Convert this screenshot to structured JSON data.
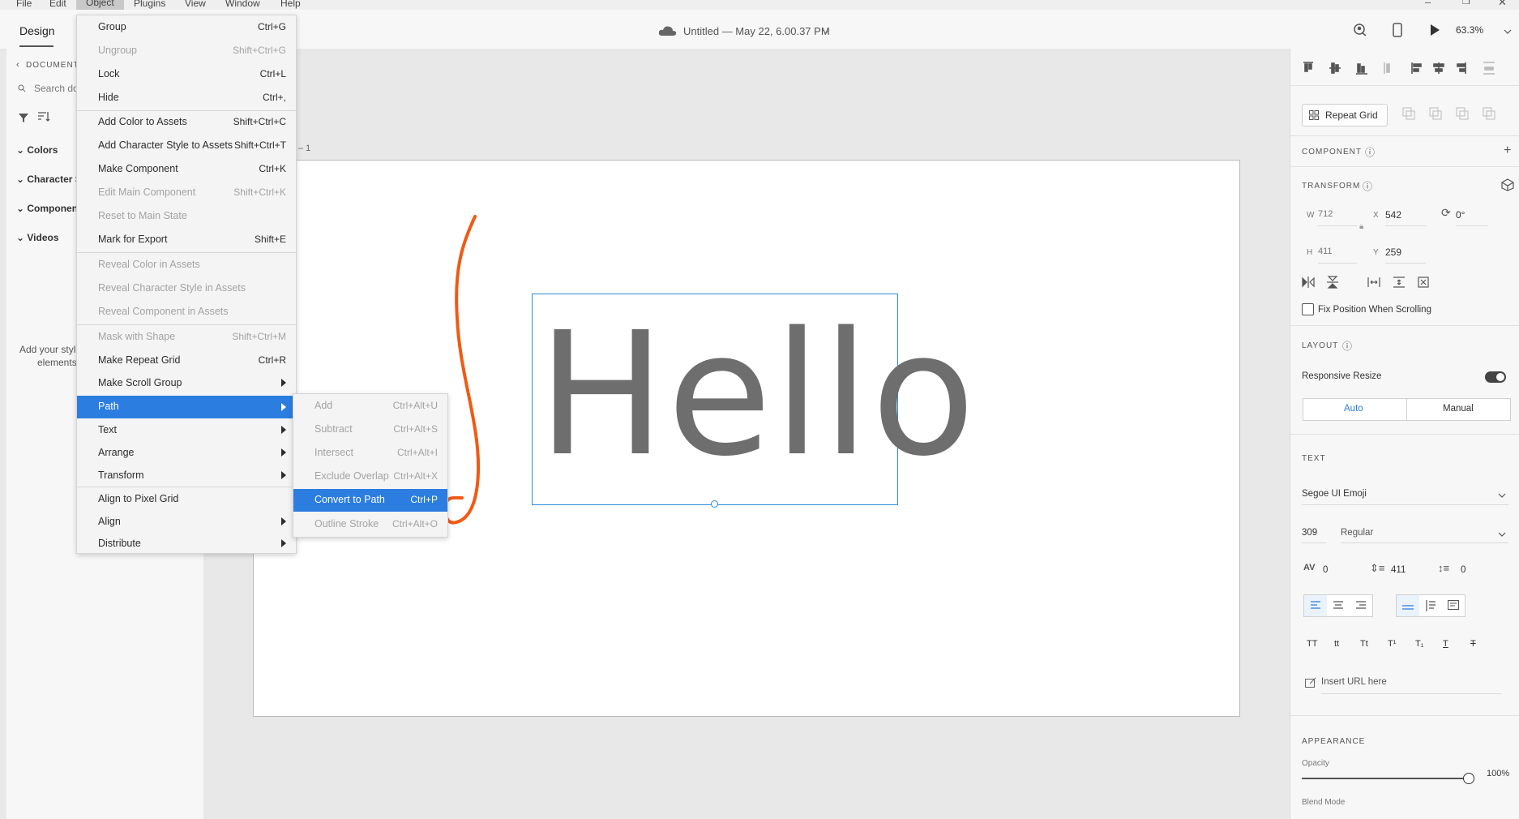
{
  "menubar": {
    "items": [
      "File",
      "Edit",
      "Object",
      "Plugins",
      "View",
      "Window",
      "Help"
    ],
    "active": "Object",
    "window_controls": [
      "–",
      "❐",
      "✕"
    ]
  },
  "header": {
    "tab_design": "Design",
    "doc_title": "Untitled — May 22, 6.00.37 PM",
    "zoom": "63.3%"
  },
  "leftpanel": {
    "back_label": "DOCUMENT",
    "search_placeholder": "Search do",
    "categories": [
      "Colors",
      "Character S",
      "Componen",
      "Videos"
    ],
    "empty_text_1": "Add your styl",
    "empty_text_2": "elements"
  },
  "artboard": {
    "label": "– 1",
    "hello_text": "Hello"
  },
  "object_menu": {
    "items": [
      {
        "label": "Group",
        "shortcut": "Ctrl+G",
        "disabled": false
      },
      {
        "label": "Ungroup",
        "shortcut": "Shift+Ctrl+G",
        "disabled": true
      },
      {
        "label": "Lock",
        "shortcut": "Ctrl+L",
        "disabled": false
      },
      {
        "label": "Hide",
        "shortcut": "Ctrl+,",
        "disabled": false
      },
      {
        "label": "Add Color to Assets",
        "shortcut": "Shift+Ctrl+C",
        "disabled": false
      },
      {
        "label": "Add Character Style to Assets",
        "shortcut": "Shift+Ctrl+T",
        "disabled": false
      },
      {
        "label": "Make Component",
        "shortcut": "Ctrl+K",
        "disabled": false
      },
      {
        "label": "Edit Main Component",
        "shortcut": "Shift+Ctrl+K",
        "disabled": true
      },
      {
        "label": "Reset to Main State",
        "shortcut": "",
        "disabled": true
      },
      {
        "label": "Mark for Export",
        "shortcut": "Shift+E",
        "disabled": false
      },
      {
        "label": "Reveal Color in Assets",
        "shortcut": "",
        "disabled": true
      },
      {
        "label": "Reveal Character Style in Assets",
        "shortcut": "",
        "disabled": true
      },
      {
        "label": "Reveal Component in Assets",
        "shortcut": "",
        "disabled": true
      },
      {
        "label": "Mask with Shape",
        "shortcut": "Shift+Ctrl+M",
        "disabled": true
      },
      {
        "label": "Make Repeat Grid",
        "shortcut": "Ctrl+R",
        "disabled": false
      },
      {
        "label": "Make Scroll Group",
        "shortcut": "",
        "disabled": false
      },
      {
        "label": "Path",
        "shortcut": "",
        "disabled": false
      },
      {
        "label": "Text",
        "shortcut": "",
        "disabled": false
      },
      {
        "label": "Arrange",
        "shortcut": "",
        "disabled": false
      },
      {
        "label": "Transform",
        "shortcut": "",
        "disabled": false
      },
      {
        "label": "Align to Pixel Grid",
        "shortcut": "",
        "disabled": false
      },
      {
        "label": "Align",
        "shortcut": "",
        "disabled": false
      },
      {
        "label": "Distribute",
        "shortcut": "",
        "disabled": false
      }
    ]
  },
  "path_menu": {
    "items": [
      {
        "label": "Add",
        "shortcut": "Ctrl+Alt+U",
        "disabled": true
      },
      {
        "label": "Subtract",
        "shortcut": "Ctrl+Alt+S",
        "disabled": true
      },
      {
        "label": "Intersect",
        "shortcut": "Ctrl+Alt+I",
        "disabled": true
      },
      {
        "label": "Exclude Overlap",
        "shortcut": "Ctrl+Alt+X",
        "disabled": true
      },
      {
        "label": "Convert to Path",
        "shortcut": "Ctrl+P",
        "disabled": false
      },
      {
        "label": "Outline Stroke",
        "shortcut": "Ctrl+Alt+O",
        "disabled": true
      }
    ]
  },
  "rightpanel": {
    "repeat_grid": "Repeat Grid",
    "component_label": "COMPONENT",
    "transform_label": "TRANSFORM",
    "w_label": "W",
    "w_value": "712",
    "x_label": "X",
    "x_value": "542",
    "rotation": "0°",
    "h_label": "H",
    "h_value": "411",
    "y_label": "Y",
    "y_value": "259",
    "fix_position": "Fix Position When Scrolling",
    "layout_label": "LAYOUT",
    "responsive_resize": "Responsive Resize",
    "auto": "Auto",
    "manual": "Manual",
    "text_label": "TEXT",
    "font_family": "Segoe UI Emoji",
    "font_size": "309",
    "font_weight": "Regular",
    "char_spacing": "0",
    "line_spacing": "411",
    "para_spacing": "0",
    "case_buttons": [
      "TT",
      "tt",
      "Tt",
      "T¹",
      "T₁",
      "T",
      "T"
    ],
    "insert_url": "Insert URL here",
    "appearance_label": "APPEARANCE",
    "opacity_label": "Opacity",
    "opacity_value": "100%",
    "blend_mode_label": "Blend Mode"
  },
  "colors": {
    "accent": "#2b7de0",
    "annotation": "#f05a14"
  }
}
